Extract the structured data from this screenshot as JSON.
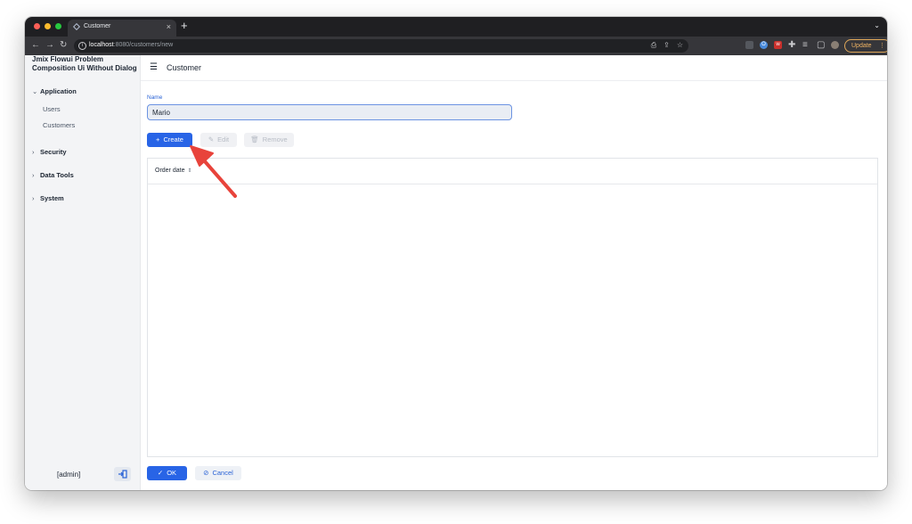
{
  "browser": {
    "tab_title": "Customer",
    "new_tab": "+",
    "tab_close": "×",
    "url_host": "localhost",
    "url_rest": ":8080/customers/new",
    "update_label": "Update"
  },
  "app": {
    "title": "Jmix Flowui Problem Composition Ui Without Dialog",
    "nav": {
      "application": "Application",
      "users": "Users",
      "customers": "Customers",
      "security": "Security",
      "data_tools": "Data Tools",
      "system": "System"
    },
    "user": "[admin]"
  },
  "page": {
    "title": "Customer",
    "name_label": "Name",
    "name_value": "Mario",
    "buttons": {
      "create": "Create",
      "edit": "Edit",
      "remove": "Remove",
      "ok": "OK",
      "cancel": "Cancel"
    },
    "grid": {
      "columns": [
        "Order date"
      ]
    }
  },
  "colors": {
    "primary": "#2864e6",
    "annotation_arrow": "#e8433b"
  }
}
